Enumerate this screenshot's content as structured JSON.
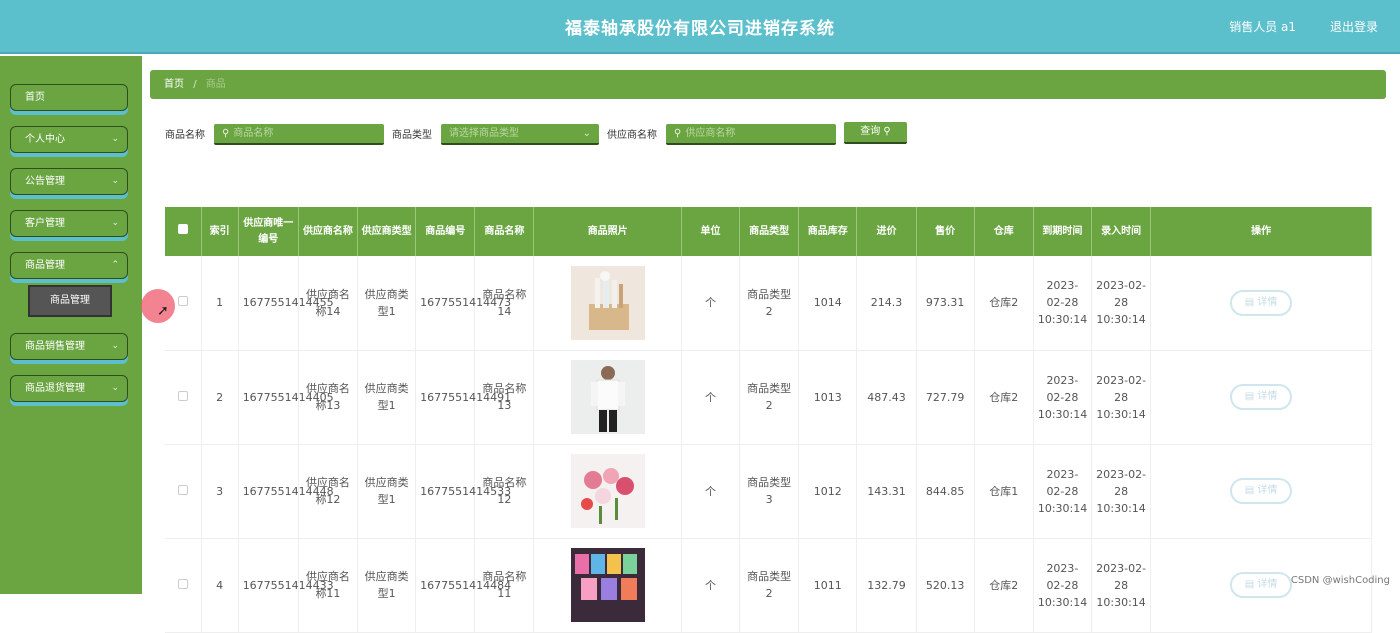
{
  "header": {
    "title": "福泰轴承股份有限公司进销存系统",
    "user": "销售人员 a1",
    "logout": "退出登录"
  },
  "sidebar": {
    "items": [
      {
        "label": "首页",
        "has_chevron": false
      },
      {
        "label": "个人中心",
        "has_chevron": true
      },
      {
        "label": "公告管理",
        "has_chevron": true
      },
      {
        "label": "客户管理",
        "has_chevron": true
      },
      {
        "label": "商品管理",
        "has_chevron": true
      },
      {
        "label": "商品销售管理",
        "has_chevron": true
      },
      {
        "label": "商品退货管理",
        "has_chevron": true
      }
    ],
    "submenu_active": "商品管理"
  },
  "breadcrumb": {
    "home": "首页",
    "sep": "/",
    "current": "商品"
  },
  "filters": {
    "name_label": "商品名称",
    "name_placeholder": "商品名称",
    "type_label": "商品类型",
    "type_placeholder": "请选择商品类型",
    "supplier_label": "供应商名称",
    "supplier_placeholder": "供应商名称",
    "search_button": "查询"
  },
  "table": {
    "headers": [
      "索引",
      "供应商唯一编号",
      "供应商名称",
      "供应商类型",
      "商品编号",
      "商品名称",
      "商品照片",
      "单位",
      "商品类型",
      "商品库存",
      "进价",
      "售价",
      "仓库",
      "到期时间",
      "录入时间",
      "操作"
    ],
    "rows": [
      {
        "index": "1",
        "supplier_id": "1677551414455",
        "supplier_name": "供应商名称14",
        "supplier_type": "供应商类型1",
        "product_id": "1677551414473",
        "product_name": "商品名称14",
        "photo": "kitchen-utensils",
        "unit": "个",
        "product_type": "商品类型2",
        "stock": "1014",
        "cost": "214.3",
        "price": "973.31",
        "warehouse": "仓库2",
        "expire": "2023-02-28 10:30:14",
        "created": "2023-02-28 10:30:14",
        "action": "详情"
      },
      {
        "index": "2",
        "supplier_id": "1677551414405",
        "supplier_name": "供应商名称13",
        "supplier_type": "供应商类型1",
        "product_id": "1677551414491",
        "product_name": "商品名称13",
        "photo": "white-shirt-man",
        "unit": "个",
        "product_type": "商品类型2",
        "stock": "1013",
        "cost": "487.43",
        "price": "727.79",
        "warehouse": "仓库2",
        "expire": "2023-02-28 10:30:14",
        "created": "2023-02-28 10:30:14",
        "action": "详情"
      },
      {
        "index": "3",
        "supplier_id": "1677551414448",
        "supplier_name": "供应商名称12",
        "supplier_type": "供应商类型1",
        "product_id": "1677551414533",
        "product_name": "商品名称12",
        "photo": "flowers",
        "unit": "个",
        "product_type": "商品类型3",
        "stock": "1012",
        "cost": "143.31",
        "price": "844.85",
        "warehouse": "仓库1",
        "expire": "2023-02-28 10:30:14",
        "created": "2023-02-28 10:30:14",
        "action": "详情"
      },
      {
        "index": "4",
        "supplier_id": "1677551414433",
        "supplier_name": "供应商名称11",
        "supplier_type": "供应商类型1",
        "product_id": "1677551414484",
        "product_name": "商品名称11",
        "photo": "colorful-banners",
        "unit": "个",
        "product_type": "商品类型2",
        "stock": "1011",
        "cost": "132.79",
        "price": "520.13",
        "warehouse": "仓库2",
        "expire": "2023-02-28 10:30:14",
        "created": "2023-02-28 10:30:14",
        "action": "详情"
      }
    ]
  },
  "watermark": "CSDN @wishCoding",
  "colors": {
    "header": "#5bbfcc",
    "accent": "#6aa542",
    "border_dark": "#2f4d1e"
  }
}
